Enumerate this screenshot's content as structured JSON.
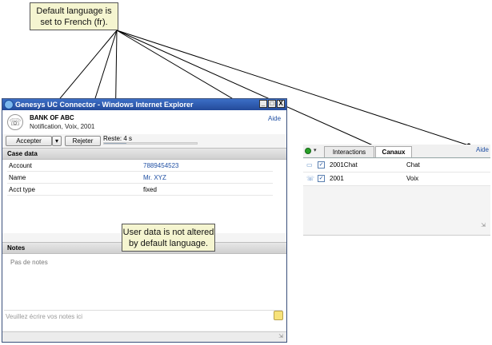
{
  "annotations": {
    "top_callout": "Default language is set to French (fr).",
    "middle_callout": "User data is not altered by default language."
  },
  "window": {
    "title": "Genesys UC Connector - Windows Internet Explorer",
    "buttons": [
      "_",
      "□",
      "X"
    ]
  },
  "interaction": {
    "company": "BANK OF ABC",
    "subtitle": "Notification, Voix, 2001",
    "help_link": "Aide",
    "accept_button": "Accepter",
    "reject_button": "Rejeter",
    "remaining": "Reste: 4 s",
    "remaining_fraction": 0.24
  },
  "case_data": {
    "title": "Case data",
    "rows": [
      {
        "key": "Account",
        "value": "7889454523"
      },
      {
        "key": "Name",
        "value": "Mr. XYZ"
      },
      {
        "key": "Acct type",
        "value": "fixed"
      }
    ]
  },
  "notes": {
    "title": "Notes",
    "empty_text": "Pas de notes",
    "input_placeholder": "Veuillez écrire vos notes ici"
  },
  "panel": {
    "tabs": [
      "Interactions",
      "Canaux"
    ],
    "active_tab": "Canaux",
    "help_link": "Aide",
    "channels": [
      {
        "name": "2001Chat",
        "type": "Chat",
        "icon": "chat-icon",
        "checked": true
      },
      {
        "name": "2001",
        "type": "Voix",
        "icon": "phone-icon",
        "checked": true
      }
    ]
  },
  "colors": {
    "titlebar": "#244a9a",
    "link": "#1f4fa3",
    "callout_bg": "#f5f5d0"
  }
}
